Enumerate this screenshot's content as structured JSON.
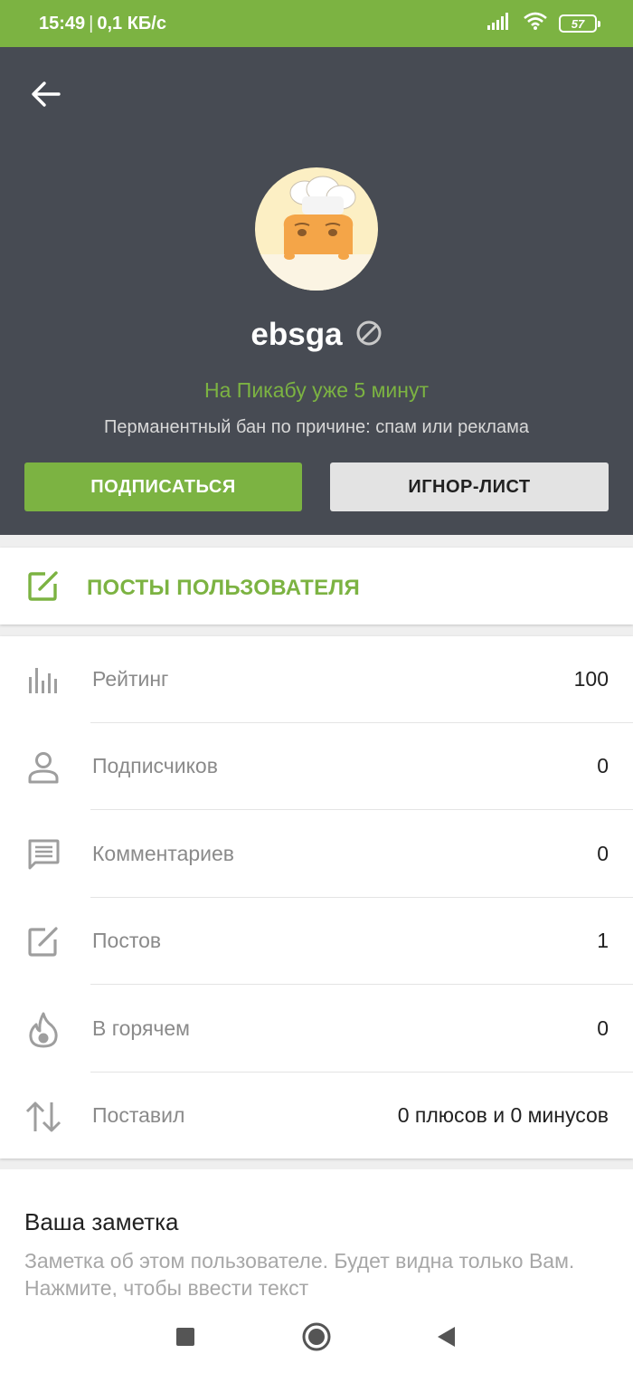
{
  "status_bar": {
    "time": "15:49",
    "separator": "|",
    "network_speed": "0,1 КБ/с",
    "battery_level": "57",
    "icons": [
      "signal-icon",
      "wifi-icon",
      "battery-icon"
    ]
  },
  "profile": {
    "username": "ebsga",
    "since": "На Пикабу уже 5 минут",
    "ban_reason": "Перманентный бан по причине: спам или реклама",
    "subscribe_label": "ПОДПИСАТЬСЯ",
    "ignore_label": "ИГНОР-ЛИСТ"
  },
  "posts_link": {
    "label": "ПОСТЫ ПОЛЬЗОВАТЕЛЯ",
    "icon": "edit-icon"
  },
  "stats": [
    {
      "icon": "rating-icon",
      "label": "Рейтинг",
      "value": "100"
    },
    {
      "icon": "person-icon",
      "label": "Подписчиков",
      "value": "0"
    },
    {
      "icon": "comment-icon",
      "label": "Комментариев",
      "value": "0"
    },
    {
      "icon": "edit-icon",
      "label": "Постов",
      "value": "1"
    },
    {
      "icon": "fire-icon",
      "label": "В горячем",
      "value": "0"
    },
    {
      "icon": "sort-arrows-icon",
      "label": "Поставил",
      "value": "0 плюсов и 0 минусов"
    }
  ],
  "note": {
    "title": "Ваша заметка",
    "hint": "Заметка об этом пользователе. Будет видна только Вам. Нажмите, чтобы ввести текст"
  },
  "colors": {
    "accent": "#7cb342",
    "header_bg": "#474b53"
  }
}
